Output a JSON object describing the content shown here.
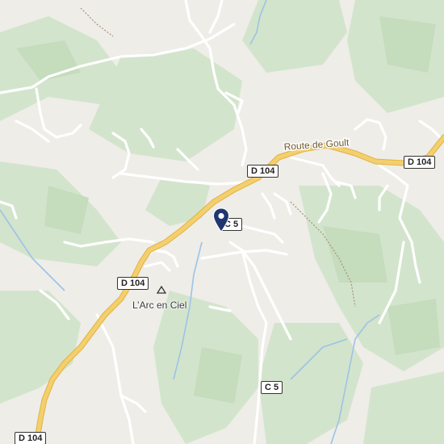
{
  "map": {
    "road_name": "Route de Goult",
    "place": {
      "name": "L’Arc en Ciel",
      "icon": "campsite-triangle-icon"
    },
    "shields": [
      {
        "label": "D 104"
      },
      {
        "label": "D 104"
      },
      {
        "label": "D 104"
      },
      {
        "label": "D 104"
      },
      {
        "label": "C 5"
      },
      {
        "label": "C 5"
      }
    ],
    "marker": {
      "icon": "location-pin-icon",
      "color": "#1f3670"
    },
    "colors": {
      "land": "#eeede8",
      "forest": "#d3e4cc",
      "forest_dark": "#c5dcbd",
      "main_road": "#f3cf6f",
      "main_road_casing": "#e3b23e",
      "minor_road": "#ffffff",
      "water": "#9cc3e8",
      "trail": "#a8907a"
    }
  }
}
